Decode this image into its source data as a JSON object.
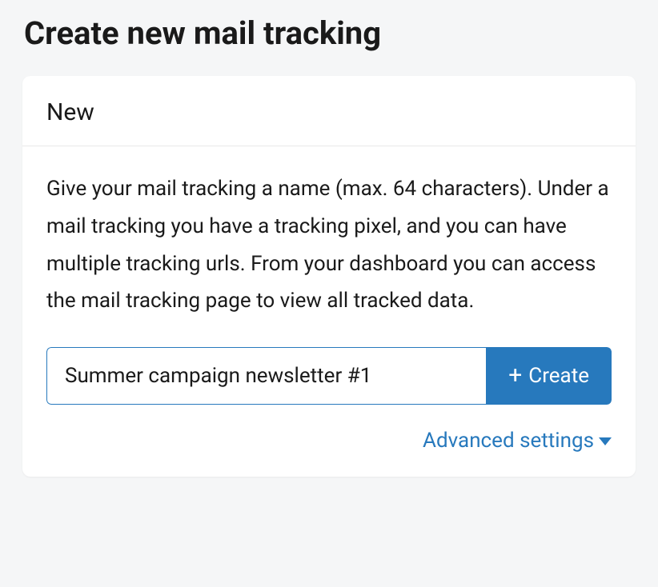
{
  "page": {
    "title": "Create new mail tracking"
  },
  "card": {
    "header_title": "New",
    "description": "Give your mail tracking a name (max. 64 characters). Under a mail tracking you have a tracking pixel, and you can have multiple tracking urls. From your dashboard you can access the mail tracking page to view all tracked data.",
    "input_value": "Summer campaign newsletter #1",
    "input_placeholder": "",
    "create_label": "Create",
    "advanced_label": "Advanced settings"
  }
}
